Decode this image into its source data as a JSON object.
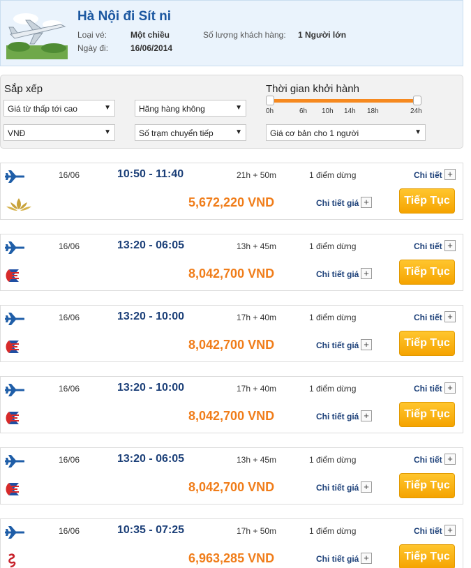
{
  "header": {
    "route_title": "Hà Nội đi Sít ni",
    "ticket_type_label": "Loại vé:",
    "ticket_type_value": "Một chiều",
    "passengers_label": "Số lượng khách hàng:",
    "passengers_value": "1 Người lớn",
    "depart_date_label": "Ngày đi:",
    "depart_date_value": "16/06/2014"
  },
  "filters": {
    "sort_heading": "Sắp xếp",
    "sort_select": "Giá từ thấp tới cao",
    "airline_select": "Hãng hàng không",
    "currency_select": "VNĐ",
    "stops_select": "Số trạm chuyển tiếp",
    "depart_time_heading": "Thời gian khởi hành",
    "slider_ticks": [
      "0h",
      "6h",
      "10h",
      "14h",
      "18h",
      "24h"
    ],
    "slider_range": [
      0,
      24
    ],
    "price_basis_select": "Giá cơ bản cho 1 người",
    "accent_color": "#f6891f"
  },
  "labels": {
    "detail": "Chi tiết",
    "price_detail": "Chi tiết giá",
    "continue": "Tiếp Tục",
    "plus": "+"
  },
  "flights": [
    {
      "date": "16/06",
      "time": "10:50 - 11:40",
      "duration": "21h + 50m",
      "stops": "1 điểm dừng",
      "price": "5,672,220 VND",
      "airline_icon": "lotus-logo-icon"
    },
    {
      "date": "16/06",
      "time": "13:20 - 06:05",
      "duration": "13h + 45m",
      "stops": "1 điểm dừng",
      "price": "8,042,700 VND",
      "airline_icon": "kite-logo-icon"
    },
    {
      "date": "16/06",
      "time": "13:20 - 10:00",
      "duration": "17h + 40m",
      "stops": "1 điểm dừng",
      "price": "8,042,700 VND",
      "airline_icon": "kite-logo-icon"
    },
    {
      "date": "16/06",
      "time": "13:20 - 10:00",
      "duration": "17h + 40m",
      "stops": "1 điểm dừng",
      "price": "8,042,700 VND",
      "airline_icon": "kite-logo-icon"
    },
    {
      "date": "16/06",
      "time": "13:20 - 06:05",
      "duration": "13h + 45m",
      "stops": "1 điểm dừng",
      "price": "8,042,700 VND",
      "airline_icon": "kite-logo-icon"
    },
    {
      "date": "16/06",
      "time": "10:35 - 07:25",
      "duration": "17h + 50m",
      "stops": "1 điểm dừng",
      "price": "6,963,285 VND",
      "airline_icon": "dragon-logo-icon"
    }
  ]
}
